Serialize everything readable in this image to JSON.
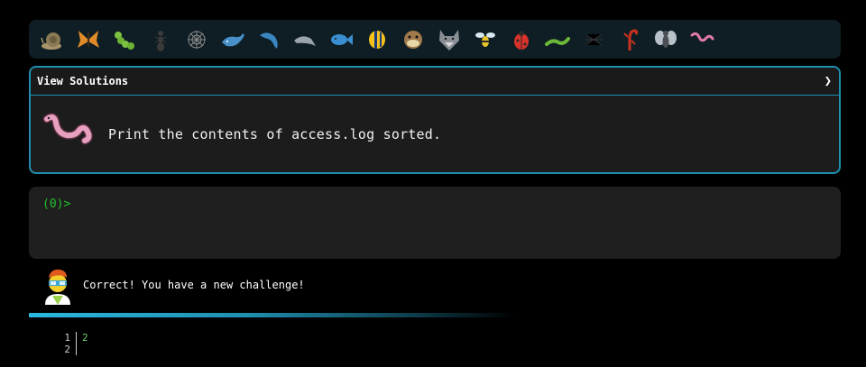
{
  "icons": [
    {
      "name": "snail-icon",
      "color": "#8a7a55"
    },
    {
      "name": "butterfly-icon",
      "color": "#e08a2a"
    },
    {
      "name": "caterpillar-icon",
      "color": "#7cc242"
    },
    {
      "name": "ant-icon",
      "color": "#2a2a2a"
    },
    {
      "name": "spider-web-icon",
      "color": "#8a8a8a"
    },
    {
      "name": "whale-icon",
      "color": "#4a90c8"
    },
    {
      "name": "dolphin-icon",
      "color": "#3a86c0"
    },
    {
      "name": "dolphin-gray-icon",
      "color": "#9aa4ac"
    },
    {
      "name": "fish-icon",
      "color": "#3a8ed0"
    },
    {
      "name": "tropical-fish-icon",
      "color": "#f2c21a"
    },
    {
      "name": "blowfish-icon",
      "color": "#a07a4a"
    },
    {
      "name": "wolf-icon",
      "color": "#8a8f96"
    },
    {
      "name": "bee-icon",
      "color": "#e8c428"
    },
    {
      "name": "ladybug-icon",
      "color": "#d8322a"
    },
    {
      "name": "worm-icon",
      "color": "#6cb83a"
    },
    {
      "name": "spider-icon",
      "color": "#2a2a2a"
    },
    {
      "name": "scorpion-icon",
      "color": "#c8321e"
    },
    {
      "name": "fly-icon",
      "color": "#7a8088"
    },
    {
      "name": "pink-worm-icon",
      "color": "#e07aa8"
    }
  ],
  "challenge": {
    "header_label": "View Solutions",
    "text": "Print the contents of access.log sorted."
  },
  "terminal": {
    "prompt": "(0)>"
  },
  "feedback": {
    "message": "Correct! You have a new challenge!"
  },
  "progress": {
    "fraction": 0.55
  },
  "output": {
    "lines": [
      {
        "no": "1",
        "value": "2"
      },
      {
        "no": "2",
        "value": ""
      }
    ]
  },
  "colors": {
    "accent": "#1f8fb0",
    "prompt_green": "#22c02a"
  }
}
